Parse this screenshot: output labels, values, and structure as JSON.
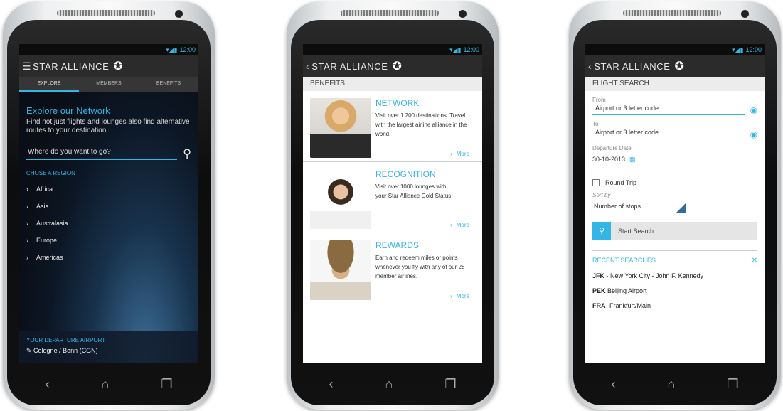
{
  "status": {
    "time": "12:00"
  },
  "brand": {
    "name": "STAR ALLIANCE",
    "accent": "#33b5e5"
  },
  "screen1": {
    "tabs": [
      "EXPLORE",
      "MEMBERS",
      "BENEFITS"
    ],
    "title": "Explore our Network",
    "subtitle": "Find not just flights and lounges also find alternative routes to your destination.",
    "search_placeholder": "Where do you want to go?",
    "region_heading": "CHOSE A REGION",
    "regions": [
      "Africa",
      "Asia",
      "Australasia",
      "Europe",
      "Americas"
    ],
    "departure_label": "YOUR DEPARTURE AIRPORT",
    "departure_value": "Cologne / Bonn (CGN)"
  },
  "screen2": {
    "header": "BENEFITS",
    "cards": [
      {
        "title": "NETWORK",
        "text": "Visit over 1 200 destinations. Travel with the largest airline alliance in the world.",
        "more": "More"
      },
      {
        "title": "RECOGNITION",
        "text": "Visit over 1000 lounges with your Star Alliance Gold Status",
        "more": "More"
      },
      {
        "title": "REWARDS",
        "text": "Earn and redeem miles or points whenever you fly with any of our 28 member airlines.",
        "more": "More"
      }
    ]
  },
  "screen3": {
    "header": "FLIGHT SEARCH",
    "from_label": "From",
    "from_placeholder": "Airport or 3 letter code",
    "to_label": "To",
    "to_placeholder": "Airport or 3 letter code",
    "date_label": "Departure Date",
    "date_value": "30-10-2013",
    "round_trip_label": "Round Trip",
    "sort_label": "Sort by",
    "sort_value": "Number of stops",
    "search_button": "Start Search",
    "recent_heading": "RECENT SEARCHES",
    "recent": [
      {
        "code": "JFK",
        "name": "- New York City - John F. Kennedy"
      },
      {
        "code": "PEK",
        "name": "Beijing Airport"
      },
      {
        "code": "FRA",
        "name": "- Frankfurt/Main"
      }
    ]
  }
}
